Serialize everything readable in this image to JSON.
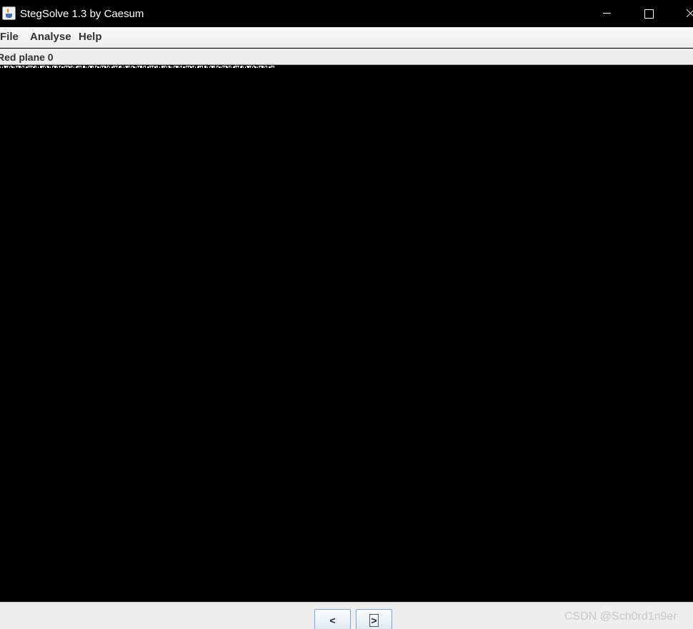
{
  "window": {
    "title": "StegSolve 1.3 by Caesum",
    "icon": "java-cup-icon"
  },
  "menu": {
    "items": [
      "File",
      "Analyse",
      "Help"
    ]
  },
  "view": {
    "plane_label": "Red plane 0"
  },
  "navigation": {
    "prev_label": "<",
    "next_label": ">"
  },
  "watermark": "CSDN @Sch0rd1n9er"
}
